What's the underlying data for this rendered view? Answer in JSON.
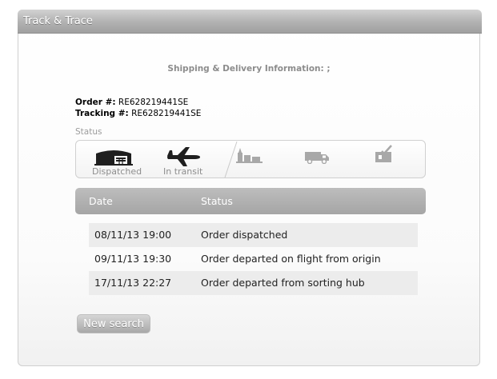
{
  "panel": {
    "title": "Track & Trace"
  },
  "info": {
    "heading": "Shipping & Delivery Information: ;",
    "order_label": "Order #:",
    "order_value": "RE628219441SE",
    "tracking_label": "Tracking #:",
    "tracking_value": "RE628219441SE"
  },
  "status": {
    "caption": "Status",
    "stages": [
      {
        "label": "Dispatched",
        "icon": "warehouse-icon",
        "state": "done"
      },
      {
        "label": "In transit",
        "icon": "airplane-icon",
        "state": "current"
      },
      {
        "label": "",
        "icon": "sorting-hub-icon",
        "state": "pending"
      },
      {
        "label": "",
        "icon": "delivery-van-icon",
        "state": "pending"
      },
      {
        "label": "",
        "icon": "delivered-box-icon",
        "state": "pending"
      }
    ]
  },
  "history": {
    "columns": [
      "Date",
      "Status"
    ],
    "rows": [
      {
        "date": "08/11/13 19:00",
        "status": "Order dispatched"
      },
      {
        "date": "09/11/13 19:30",
        "status": "Order departed on flight from origin"
      },
      {
        "date": "17/11/13 22:27",
        "status": "Order departed from sorting hub"
      }
    ]
  },
  "actions": {
    "new_search_label": "New search"
  },
  "colors": {
    "header_gradient": "#b1b1b1",
    "active_icon": "#1f1f1f",
    "inactive_icon": "#a8a8a8",
    "row_shade": "#ececec"
  }
}
